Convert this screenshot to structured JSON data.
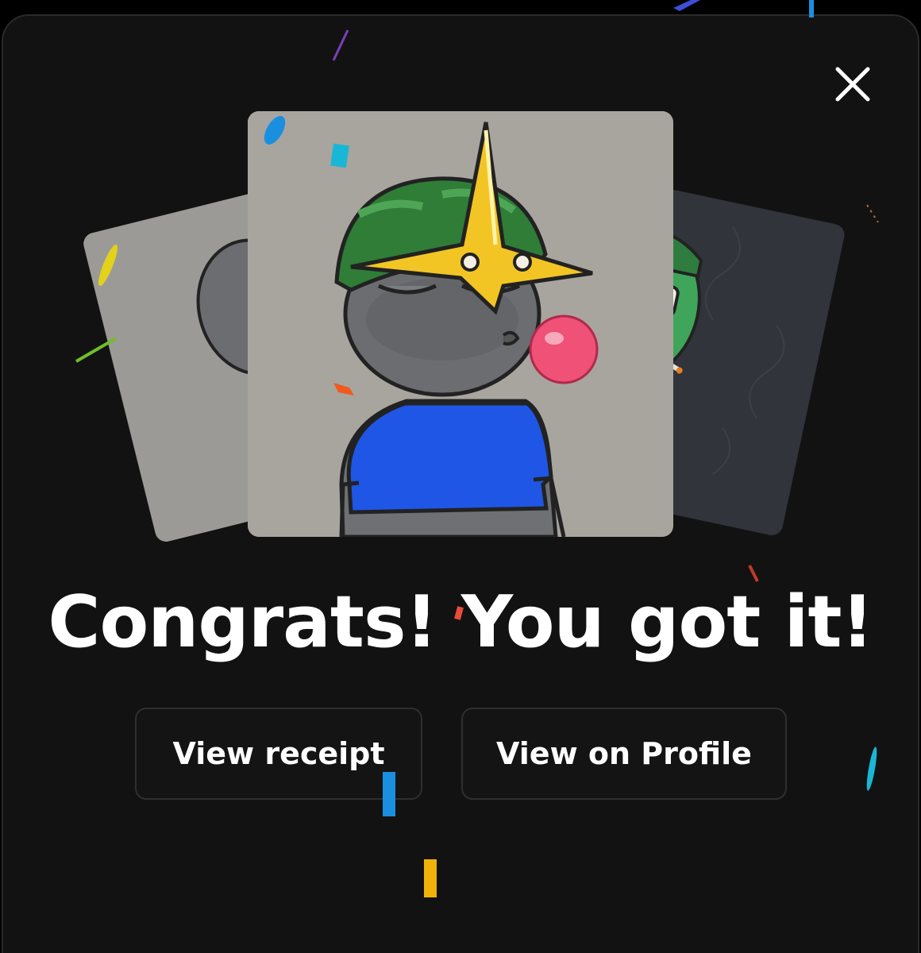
{
  "dialog": {
    "headline": "Congrats! You got it!",
    "close_label": "Close"
  },
  "actions": {
    "view_receipt": "View receipt",
    "view_on_profile": "View on Profile"
  },
  "nft_cards": [
    {
      "position": "left",
      "background": "#9c9a97"
    },
    {
      "position": "center",
      "background": "#a8a59f"
    },
    {
      "position": "right",
      "background": "#31343b"
    }
  ],
  "colors": {
    "page_background": "#000000",
    "modal_background": "#121212",
    "button_border": "#2f2f2f",
    "text": "#ffffff"
  }
}
